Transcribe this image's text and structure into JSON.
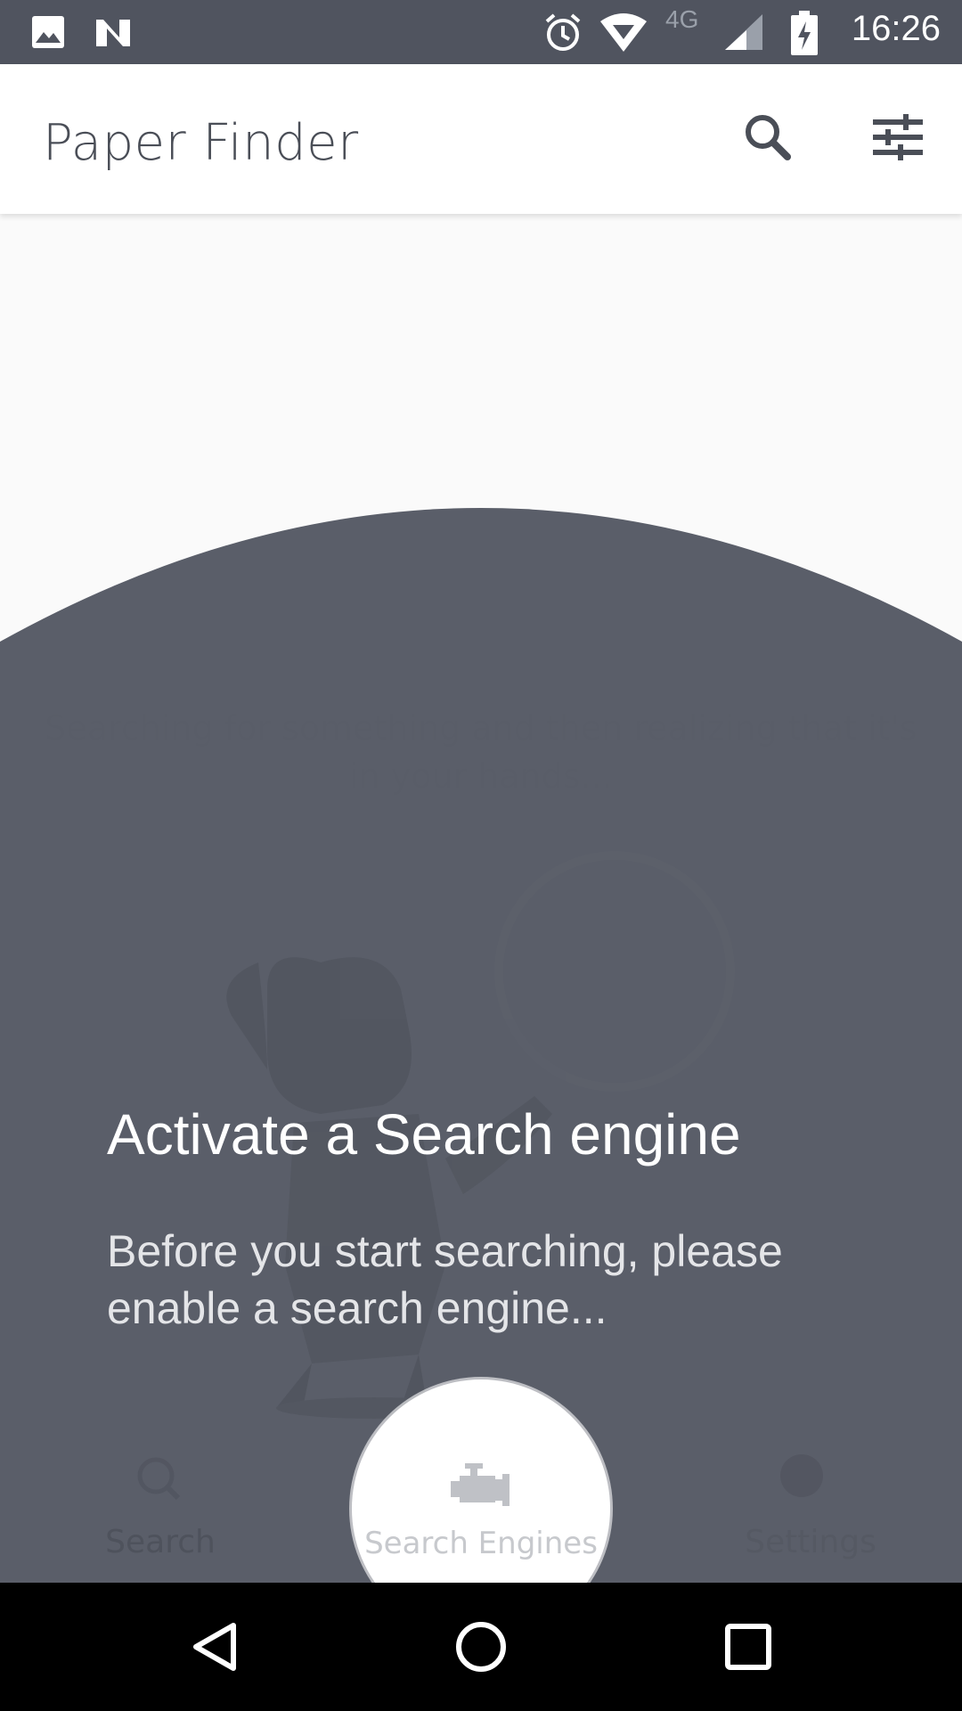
{
  "status_bar": {
    "time": "16:26",
    "network": "4G",
    "icons": [
      "image-icon",
      "n-notification-icon",
      "alarm-icon",
      "wifi-icon",
      "signal-icon",
      "battery-charging-icon"
    ]
  },
  "app_bar": {
    "title": "Paper Finder",
    "actions": [
      "search-icon",
      "filter-tune-icon"
    ]
  },
  "background": {
    "quote": "Searching for something and then realizing that it's in your hands..."
  },
  "showcase": {
    "title": "Activate a Search engine",
    "description": "Before you start searching, please enable a search engine...",
    "target_label": "Search Engines",
    "target_icon": "engine-icon"
  },
  "bottom_nav": {
    "items": [
      {
        "label": "Search",
        "icon": "search-icon"
      },
      {
        "label": "Search Engines",
        "icon": "engine-icon"
      },
      {
        "label": "Settings",
        "icon": "settings-icon"
      }
    ]
  },
  "colors": {
    "status_bar": "#50545f",
    "overlay": "#555964",
    "app_bar": "#ffffff",
    "text_primary": "#4a4e57"
  }
}
